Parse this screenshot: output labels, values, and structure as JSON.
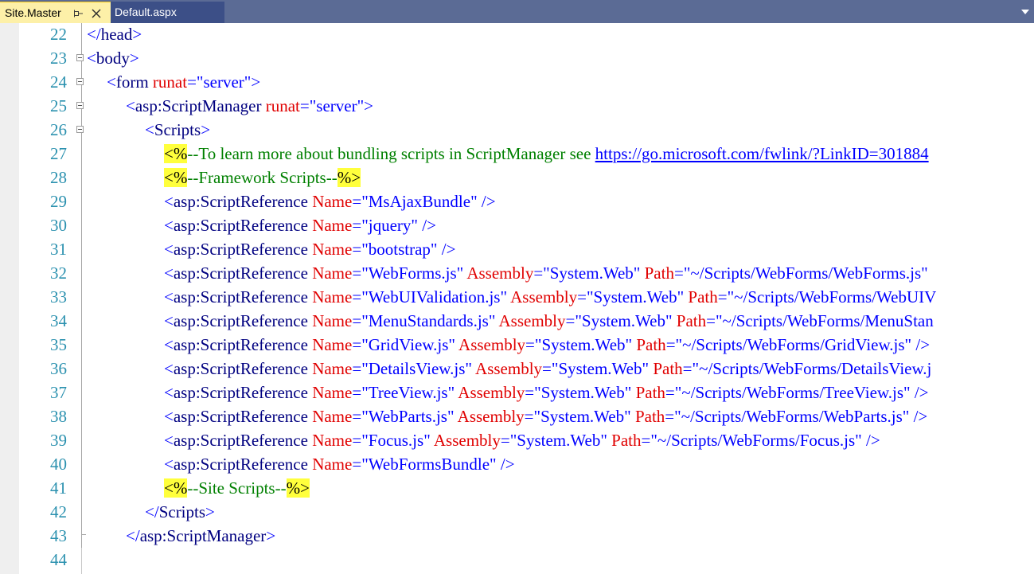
{
  "tabs": [
    {
      "label": "Site.Master",
      "active": true
    },
    {
      "label": "Default.aspx",
      "active": false
    }
  ],
  "icons": {
    "pin": "pin-icon",
    "close": "close-icon",
    "dropdown": "chevron-down-icon"
  },
  "colors": {
    "tab_strip": "#5b6b95",
    "active_tab": "#fdf0a8",
    "line_number": "#2b91af",
    "bracket": "#0000ff",
    "tag": "#000080",
    "attribute": "#e00000",
    "comment": "#008000",
    "highlight": "#ffff3c"
  },
  "editor": {
    "lines": [
      {
        "num": "22",
        "tokens": [
          {
            "t": "br",
            "s": "</"
          },
          {
            "t": "tag",
            "s": "head"
          },
          {
            "t": "br",
            "s": ">"
          }
        ]
      },
      {
        "num": "23",
        "tokens": [
          {
            "t": "br",
            "s": "<"
          },
          {
            "t": "tag",
            "s": "body"
          },
          {
            "t": "br",
            "s": ">"
          }
        ]
      },
      {
        "num": "24",
        "tokens": [
          {
            "t": "br",
            "s": "<"
          },
          {
            "t": "tag",
            "s": "form"
          },
          {
            "t": "attr",
            "s": " runat"
          },
          {
            "t": "br",
            "s": "="
          },
          {
            "t": "val",
            "s": "\"server\""
          },
          {
            "t": "br",
            "s": ">"
          }
        ]
      },
      {
        "num": "25",
        "tokens": [
          {
            "t": "br",
            "s": "<"
          },
          {
            "t": "tag",
            "s": "asp:ScriptManager"
          },
          {
            "t": "attr",
            "s": " runat"
          },
          {
            "t": "br",
            "s": "="
          },
          {
            "t": "val",
            "s": "\"server\""
          },
          {
            "t": "br",
            "s": ">"
          }
        ]
      },
      {
        "num": "26",
        "tokens": [
          {
            "t": "br",
            "s": "<"
          },
          {
            "t": "tag",
            "s": "Scripts"
          },
          {
            "t": "br",
            "s": ">"
          }
        ]
      },
      {
        "num": "27",
        "tokens": [
          {
            "t": "hl",
            "s": "<%"
          },
          {
            "t": "cmt",
            "s": "--To learn more about bundling scripts in ScriptManager see "
          },
          {
            "t": "link",
            "s": "https://go.microsoft.com/fwlink/?LinkID=301884"
          }
        ]
      },
      {
        "num": "28",
        "tokens": [
          {
            "t": "hl",
            "s": "<%"
          },
          {
            "t": "cmt",
            "s": "--Framework Scripts--"
          },
          {
            "t": "hl",
            "s": "%>"
          }
        ]
      },
      {
        "num": "29",
        "tokens": [
          {
            "t": "br",
            "s": "<"
          },
          {
            "t": "tag",
            "s": "asp:ScriptReference"
          },
          {
            "t": "attr",
            "s": " Name"
          },
          {
            "t": "br",
            "s": "="
          },
          {
            "t": "val",
            "s": "\"MsAjaxBundle\""
          },
          {
            "t": "br",
            "s": " />"
          }
        ]
      },
      {
        "num": "30",
        "tokens": [
          {
            "t": "br",
            "s": "<"
          },
          {
            "t": "tag",
            "s": "asp:ScriptReference"
          },
          {
            "t": "attr",
            "s": " Name"
          },
          {
            "t": "br",
            "s": "="
          },
          {
            "t": "val",
            "s": "\"jquery\""
          },
          {
            "t": "br",
            "s": " />"
          }
        ]
      },
      {
        "num": "31",
        "tokens": [
          {
            "t": "br",
            "s": "<"
          },
          {
            "t": "tag",
            "s": "asp:ScriptReference"
          },
          {
            "t": "attr",
            "s": " Name"
          },
          {
            "t": "br",
            "s": "="
          },
          {
            "t": "val",
            "s": "\"bootstrap\""
          },
          {
            "t": "br",
            "s": " />"
          }
        ]
      },
      {
        "num": "32",
        "tokens": [
          {
            "t": "br",
            "s": "<"
          },
          {
            "t": "tag",
            "s": "asp:ScriptReference"
          },
          {
            "t": "attr",
            "s": " Name"
          },
          {
            "t": "br",
            "s": "="
          },
          {
            "t": "val",
            "s": "\"WebForms.js\""
          },
          {
            "t": "attr",
            "s": " Assembly"
          },
          {
            "t": "br",
            "s": "="
          },
          {
            "t": "val",
            "s": "\"System.Web\""
          },
          {
            "t": "attr",
            "s": " Path"
          },
          {
            "t": "br",
            "s": "="
          },
          {
            "t": "val",
            "s": "\"~/Scripts/WebForms/WebForms.js\""
          }
        ]
      },
      {
        "num": "33",
        "tokens": [
          {
            "t": "br",
            "s": "<"
          },
          {
            "t": "tag",
            "s": "asp:ScriptReference"
          },
          {
            "t": "attr",
            "s": " Name"
          },
          {
            "t": "br",
            "s": "="
          },
          {
            "t": "val",
            "s": "\"WebUIValidation.js\""
          },
          {
            "t": "attr",
            "s": " Assembly"
          },
          {
            "t": "br",
            "s": "="
          },
          {
            "t": "val",
            "s": "\"System.Web\""
          },
          {
            "t": "attr",
            "s": " Path"
          },
          {
            "t": "br",
            "s": "="
          },
          {
            "t": "val",
            "s": "\"~/Scripts/WebForms/WebUIV"
          }
        ]
      },
      {
        "num": "34",
        "tokens": [
          {
            "t": "br",
            "s": "<"
          },
          {
            "t": "tag",
            "s": "asp:ScriptReference"
          },
          {
            "t": "attr",
            "s": " Name"
          },
          {
            "t": "br",
            "s": "="
          },
          {
            "t": "val",
            "s": "\"MenuStandards.js\""
          },
          {
            "t": "attr",
            "s": " Assembly"
          },
          {
            "t": "br",
            "s": "="
          },
          {
            "t": "val",
            "s": "\"System.Web\""
          },
          {
            "t": "attr",
            "s": " Path"
          },
          {
            "t": "br",
            "s": "="
          },
          {
            "t": "val",
            "s": "\"~/Scripts/WebForms/MenuStan"
          }
        ]
      },
      {
        "num": "35",
        "tokens": [
          {
            "t": "br",
            "s": "<"
          },
          {
            "t": "tag",
            "s": "asp:ScriptReference"
          },
          {
            "t": "attr",
            "s": " Name"
          },
          {
            "t": "br",
            "s": "="
          },
          {
            "t": "val",
            "s": "\"GridView.js\""
          },
          {
            "t": "attr",
            "s": " Assembly"
          },
          {
            "t": "br",
            "s": "="
          },
          {
            "t": "val",
            "s": "\"System.Web\""
          },
          {
            "t": "attr",
            "s": " Path"
          },
          {
            "t": "br",
            "s": "="
          },
          {
            "t": "val",
            "s": "\"~/Scripts/WebForms/GridView.js\""
          },
          {
            "t": "br",
            "s": " />"
          }
        ]
      },
      {
        "num": "36",
        "tokens": [
          {
            "t": "br",
            "s": "<"
          },
          {
            "t": "tag",
            "s": "asp:ScriptReference"
          },
          {
            "t": "attr",
            "s": " Name"
          },
          {
            "t": "br",
            "s": "="
          },
          {
            "t": "val",
            "s": "\"DetailsView.js\""
          },
          {
            "t": "attr",
            "s": " Assembly"
          },
          {
            "t": "br",
            "s": "="
          },
          {
            "t": "val",
            "s": "\"System.Web\""
          },
          {
            "t": "attr",
            "s": " Path"
          },
          {
            "t": "br",
            "s": "="
          },
          {
            "t": "val",
            "s": "\"~/Scripts/WebForms/DetailsView.j"
          }
        ]
      },
      {
        "num": "37",
        "tokens": [
          {
            "t": "br",
            "s": "<"
          },
          {
            "t": "tag",
            "s": "asp:ScriptReference"
          },
          {
            "t": "attr",
            "s": " Name"
          },
          {
            "t": "br",
            "s": "="
          },
          {
            "t": "val",
            "s": "\"TreeView.js\""
          },
          {
            "t": "attr",
            "s": " Assembly"
          },
          {
            "t": "br",
            "s": "="
          },
          {
            "t": "val",
            "s": "\"System.Web\""
          },
          {
            "t": "attr",
            "s": " Path"
          },
          {
            "t": "br",
            "s": "="
          },
          {
            "t": "val",
            "s": "\"~/Scripts/WebForms/TreeView.js\""
          },
          {
            "t": "br",
            "s": " />"
          }
        ]
      },
      {
        "num": "38",
        "tokens": [
          {
            "t": "br",
            "s": "<"
          },
          {
            "t": "tag",
            "s": "asp:ScriptReference"
          },
          {
            "t": "attr",
            "s": " Name"
          },
          {
            "t": "br",
            "s": "="
          },
          {
            "t": "val",
            "s": "\"WebParts.js\""
          },
          {
            "t": "attr",
            "s": " Assembly"
          },
          {
            "t": "br",
            "s": "="
          },
          {
            "t": "val",
            "s": "\"System.Web\""
          },
          {
            "t": "attr",
            "s": " Path"
          },
          {
            "t": "br",
            "s": "="
          },
          {
            "t": "val",
            "s": "\"~/Scripts/WebForms/WebParts.js\""
          },
          {
            "t": "br",
            "s": " />"
          }
        ]
      },
      {
        "num": "39",
        "tokens": [
          {
            "t": "br",
            "s": "<"
          },
          {
            "t": "tag",
            "s": "asp:ScriptReference"
          },
          {
            "t": "attr",
            "s": " Name"
          },
          {
            "t": "br",
            "s": "="
          },
          {
            "t": "val",
            "s": "\"Focus.js\""
          },
          {
            "t": "attr",
            "s": " Assembly"
          },
          {
            "t": "br",
            "s": "="
          },
          {
            "t": "val",
            "s": "\"System.Web\""
          },
          {
            "t": "attr",
            "s": " Path"
          },
          {
            "t": "br",
            "s": "="
          },
          {
            "t": "val",
            "s": "\"~/Scripts/WebForms/Focus.js\""
          },
          {
            "t": "br",
            "s": " />"
          }
        ]
      },
      {
        "num": "40",
        "tokens": [
          {
            "t": "br",
            "s": "<"
          },
          {
            "t": "tag",
            "s": "asp:ScriptReference"
          },
          {
            "t": "attr",
            "s": " Name"
          },
          {
            "t": "br",
            "s": "="
          },
          {
            "t": "val",
            "s": "\"WebFormsBundle\""
          },
          {
            "t": "br",
            "s": " />"
          }
        ]
      },
      {
        "num": "41",
        "tokens": [
          {
            "t": "hl",
            "s": "<%"
          },
          {
            "t": "cmt",
            "s": "--Site Scripts--"
          },
          {
            "t": "hl",
            "s": "%>"
          }
        ]
      },
      {
        "num": "42",
        "tokens": [
          {
            "t": "br",
            "s": "</"
          },
          {
            "t": "tag",
            "s": "Scripts"
          },
          {
            "t": "br",
            "s": ">"
          }
        ]
      },
      {
        "num": "43",
        "tokens": [
          {
            "t": "br",
            "s": "</"
          },
          {
            "t": "tag",
            "s": "asp:ScriptManager"
          },
          {
            "t": "br",
            "s": ">"
          }
        ]
      },
      {
        "num": "44",
        "tokens": []
      }
    ]
  }
}
